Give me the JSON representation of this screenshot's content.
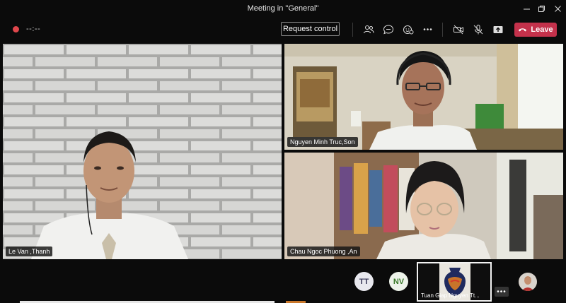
{
  "window": {
    "title": "Meeting in \"General\""
  },
  "toolbar": {
    "timer": "--:--",
    "request_control_label": "Request control",
    "leave_label": "Leave",
    "more_label": "•••",
    "accent_red": "#c4314b"
  },
  "participants": {
    "main": {
      "name": "Le Van ,Thanh"
    },
    "top_right": {
      "name": "Nguyen Minh Truc,Son"
    },
    "bottom_right": {
      "name": "Chau Ngoc Phuong ,An"
    }
  },
  "roster": {
    "avatar_tt": {
      "initials": "TT",
      "bg": "#e8e8ee",
      "fg": "#3a3a5a"
    },
    "avatar_nv": {
      "initials": "NV",
      "bg": "#eef3ea",
      "fg": "#3b7a2a"
    },
    "thumbnail_name": "Tuan Giap Nguyen Tt...",
    "more_label": "•••"
  }
}
